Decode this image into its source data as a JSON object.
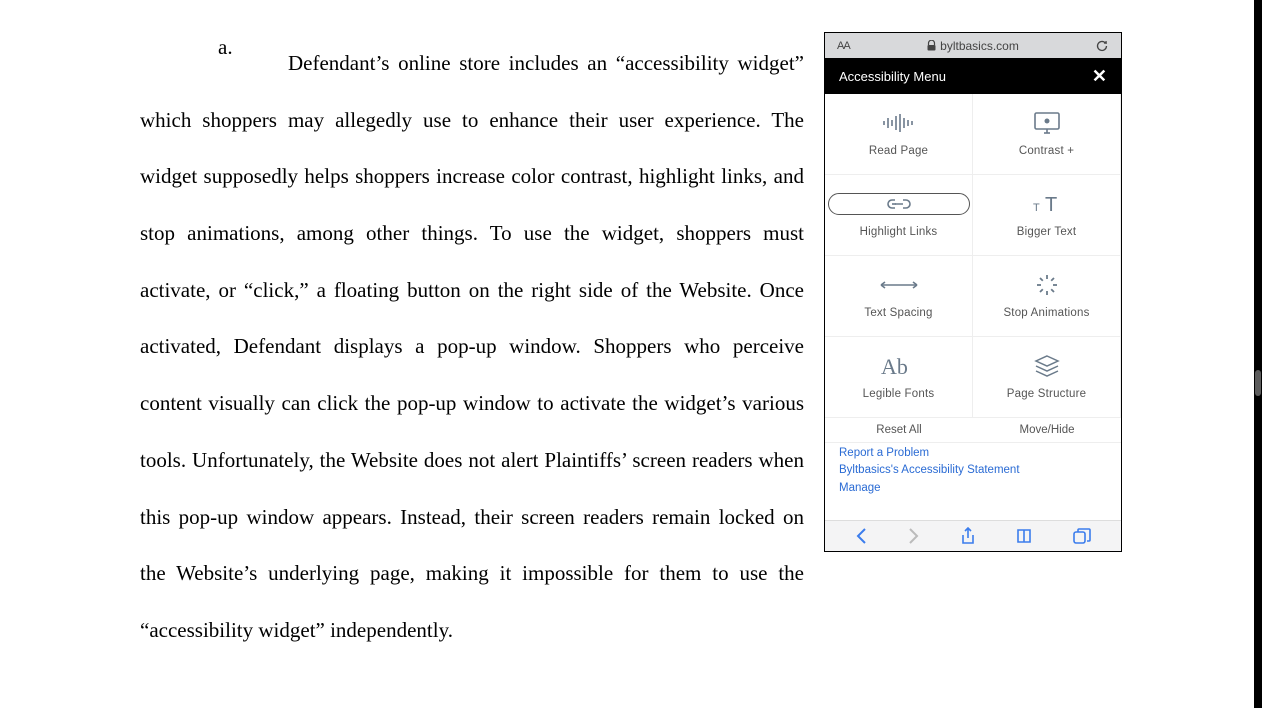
{
  "document": {
    "list_marker": "a.",
    "paragraph": "Defendant’s online store includes an “accessibility widget” which shoppers may allegedly use to enhance their user experience. The widget supposedly helps shoppers increase color contrast, highlight links, and stop animations, among other things. To use the widget, shoppers must activate, or “click,” a floating button on the right side of the Website. Once activated, Defendant displays a pop-up window. Shoppers who perceive content visually can click the pop-up window to activate the widget’s various tools. Unfortunately, the Website does not alert Plaintiffs’ screen readers when this pop-up window appears. Instead, their screen readers remain locked on the Website’s underlying page, making it impossible for them to use the “accessibility widget” independently."
  },
  "screenshot": {
    "browser": {
      "aa": "AA",
      "url": "byltbasics.com"
    },
    "menu_title": "Accessibility Menu",
    "tiles": [
      {
        "label": "Read Page"
      },
      {
        "label": "Contrast +"
      },
      {
        "label": "Highlight Links"
      },
      {
        "label": "Bigger Text"
      },
      {
        "label": "Text Spacing"
      },
      {
        "label": "Stop Animations"
      },
      {
        "label": "Legible Fonts"
      },
      {
        "label": "Page Structure"
      }
    ],
    "footer_actions": {
      "reset": "Reset All",
      "move": "Move/Hide"
    },
    "links": {
      "report": "Report a Problem",
      "statement": "Byltbasics's Accessibility Statement",
      "manage": "Manage"
    }
  }
}
